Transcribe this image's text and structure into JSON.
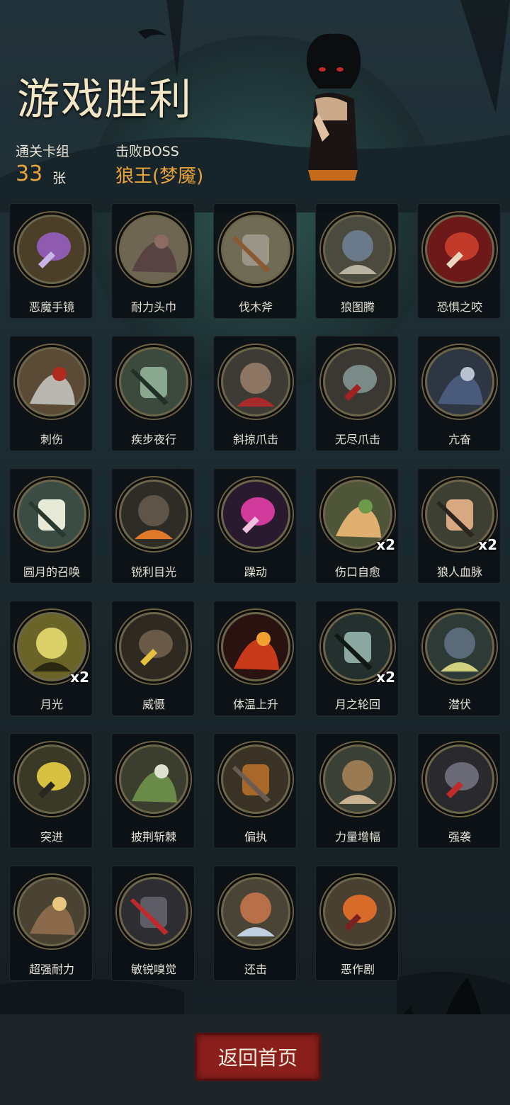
{
  "header": {
    "title": "游戏胜利",
    "deck_label": "通关卡组",
    "deck_count": "33",
    "deck_unit": "张",
    "boss_label": "击败BOSS",
    "boss_name": "狼王(梦魇)"
  },
  "colors": {
    "accent": "#e8a43a",
    "button": "#8b1f1c",
    "card_ring": "#6d6244",
    "panel": "#0b1014"
  },
  "cards": [
    {
      "name": "恶魔手镜",
      "icon": "demon-hand-mirror-icon",
      "badge": ""
    },
    {
      "name": "耐力头巾",
      "icon": "bandana-icon",
      "badge": ""
    },
    {
      "name": "伐木斧",
      "icon": "axe-icon",
      "badge": ""
    },
    {
      "name": "狼图腾",
      "icon": "wolf-totem-icon",
      "badge": ""
    },
    {
      "name": "恐惧之咬",
      "icon": "fear-bite-icon",
      "badge": ""
    },
    {
      "name": "刺伤",
      "icon": "stab-icon",
      "badge": ""
    },
    {
      "name": "疾步夜行",
      "icon": "night-run-icon",
      "badge": ""
    },
    {
      "name": "斜掠爪击",
      "icon": "slash-claw-icon",
      "badge": ""
    },
    {
      "name": "无尽爪击",
      "icon": "endless-claw-icon",
      "badge": ""
    },
    {
      "name": "亢奋",
      "icon": "frenzy-icon",
      "badge": ""
    },
    {
      "name": "圆月的召唤",
      "icon": "full-moon-call-icon",
      "badge": ""
    },
    {
      "name": "锐利目光",
      "icon": "sharp-gaze-icon",
      "badge": ""
    },
    {
      "name": "躁动",
      "icon": "restless-icon",
      "badge": ""
    },
    {
      "name": "伤口自愈",
      "icon": "wound-heal-icon",
      "badge": "x2"
    },
    {
      "name": "狼人血脉",
      "icon": "werewolf-blood-icon",
      "badge": "x2"
    },
    {
      "name": "月光",
      "icon": "moonlight-icon",
      "badge": "x2"
    },
    {
      "name": "威慑",
      "icon": "intimidate-icon",
      "badge": ""
    },
    {
      "name": "体温上升",
      "icon": "heat-rise-icon",
      "badge": ""
    },
    {
      "name": "月之轮回",
      "icon": "moon-cycle-icon",
      "badge": "x2"
    },
    {
      "name": "潜伏",
      "icon": "lurk-icon",
      "badge": ""
    },
    {
      "name": "突进",
      "icon": "charge-icon",
      "badge": ""
    },
    {
      "name": "披荆斩棘",
      "icon": "blade-thorns-icon",
      "badge": ""
    },
    {
      "name": "偏执",
      "icon": "paranoia-icon",
      "badge": ""
    },
    {
      "name": "力量增幅",
      "icon": "power-boost-icon",
      "badge": ""
    },
    {
      "name": "强袭",
      "icon": "assault-icon",
      "badge": ""
    },
    {
      "name": "超强耐力",
      "icon": "super-stamina-icon",
      "badge": ""
    },
    {
      "name": "敏锐嗅觉",
      "icon": "keen-smell-icon",
      "badge": ""
    },
    {
      "name": "还击",
      "icon": "counter-attack-icon",
      "badge": ""
    },
    {
      "name": "恶作剧",
      "icon": "prank-icon",
      "badge": ""
    }
  ],
  "footer": {
    "home_button": "返回首页"
  }
}
